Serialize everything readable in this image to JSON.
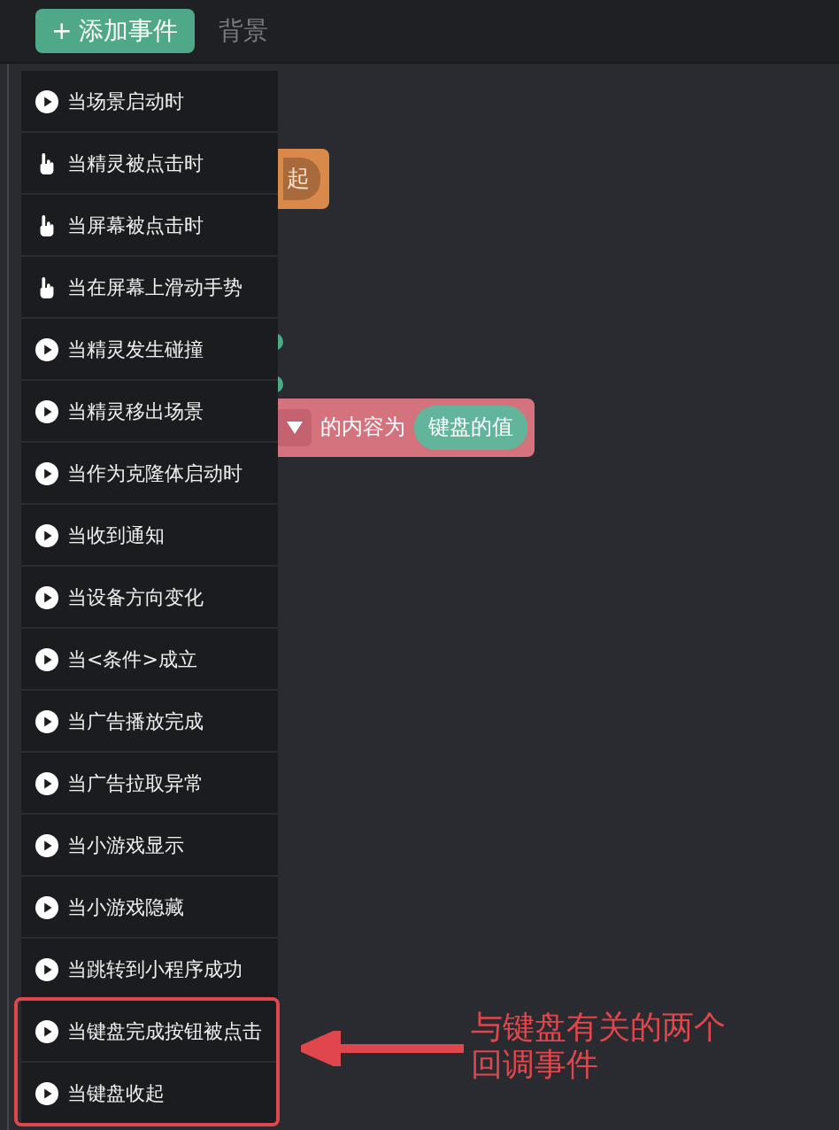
{
  "toolbar": {
    "add_button": {
      "icon": "+",
      "label": "添加事件"
    },
    "tabs": [
      {
        "label": "背景",
        "selected": false
      }
    ]
  },
  "canvas_blocks": [
    {
      "kind": "orange",
      "texts": [
        "起"
      ]
    },
    {
      "kind": "pink",
      "texts": [
        "的内容为"
      ],
      "pill": "键盘的值"
    }
  ],
  "event_menu": {
    "items": [
      {
        "kind": "play",
        "label": "当场景启动时",
        "highlighted": false
      },
      {
        "kind": "hand",
        "label": "当精灵被点击时",
        "highlighted": false
      },
      {
        "kind": "hand",
        "label": "当屏幕被点击时",
        "highlighted": false
      },
      {
        "kind": "hand",
        "label": "当在屏幕上滑动手势",
        "highlighted": false
      },
      {
        "kind": "play",
        "label": "当精灵发生碰撞",
        "highlighted": false
      },
      {
        "kind": "play",
        "label": "当精灵移出场景",
        "highlighted": false
      },
      {
        "kind": "play",
        "label": "当作为克隆体启动时",
        "highlighted": false
      },
      {
        "kind": "play",
        "label": "当收到通知",
        "highlighted": false
      },
      {
        "kind": "play",
        "label": "当设备方向变化",
        "highlighted": false
      },
      {
        "kind": "play",
        "label": "当<条件>成立",
        "highlighted": false
      },
      {
        "kind": "play",
        "label": "当广告播放完成",
        "highlighted": false
      },
      {
        "kind": "play",
        "label": "当广告拉取异常",
        "highlighted": false
      },
      {
        "kind": "play",
        "label": "当小游戏显示",
        "highlighted": false
      },
      {
        "kind": "play",
        "label": "当小游戏隐藏",
        "highlighted": false
      },
      {
        "kind": "play",
        "label": "当跳转到小程序成功",
        "highlighted": false
      },
      {
        "kind": "play",
        "label": "当键盘完成按钮被点击",
        "highlighted": true
      },
      {
        "kind": "play",
        "label": "当键盘收起",
        "highlighted": true
      }
    ]
  },
  "annotation": {
    "text": "与键盘有关的两个回调事件"
  }
}
